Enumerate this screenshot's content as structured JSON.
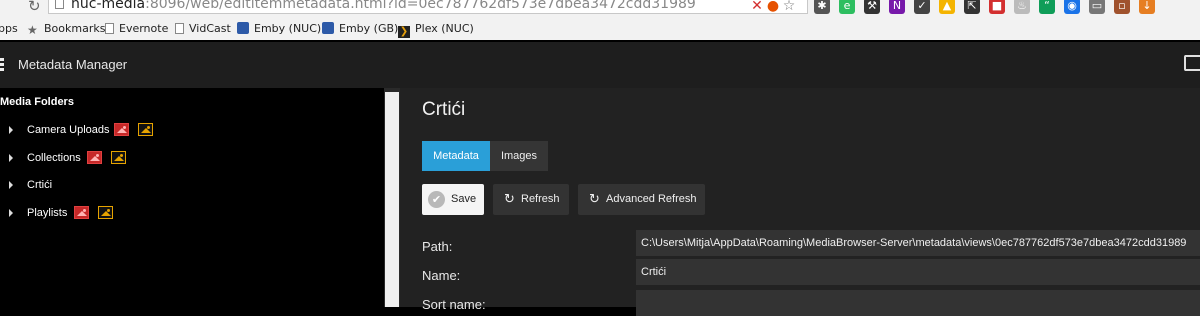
{
  "browser": {
    "url_host": "nuc-media",
    "url_rest": ":8096/web/edititemmetadata.html?id=0ec787762df573e7dbea3472cdd31989",
    "bookmarks": [
      {
        "label": "pps",
        "icon": "apps-icon"
      },
      {
        "label": "Bookmarks",
        "icon": "star-icon"
      },
      {
        "label": "Evernote",
        "icon": "page-icon"
      },
      {
        "label": "VidCast",
        "icon": "page-icon"
      },
      {
        "label": "Emby (NUC)",
        "icon": "emby-icon"
      },
      {
        "label": "Emby (GB)",
        "icon": "emby-icon"
      },
      {
        "label": "Plex (NUC)",
        "icon": "plex-icon"
      }
    ],
    "extensions": [
      {
        "icon": "puzzle-icon",
        "color": "#555555"
      },
      {
        "icon": "evernote-icon",
        "color": "#2dbe60"
      },
      {
        "icon": "tool-icon",
        "color": "#333333"
      },
      {
        "icon": "onenote-icon",
        "color": "#7719aa"
      },
      {
        "icon": "pocket-icon",
        "color": "#444444"
      },
      {
        "icon": "drive-icon",
        "color": "#f4b400"
      },
      {
        "icon": "pin-icon",
        "color": "#333333"
      },
      {
        "icon": "pdf-icon",
        "color": "#d32f2f"
      },
      {
        "icon": "bell-icon",
        "color": "#bbbbbb"
      },
      {
        "icon": "hangouts-icon",
        "color": "#0f9d58"
      },
      {
        "icon": "globe-icon",
        "color": "#1a73e8"
      },
      {
        "icon": "cast-icon",
        "color": "#777777"
      },
      {
        "icon": "briefcase-icon",
        "color": "#a0522d"
      },
      {
        "icon": "download-icon",
        "color": "#e67e22"
      }
    ]
  },
  "header": {
    "title": "Metadata Manager"
  },
  "sidebar": {
    "heading": "Media Folders",
    "items": [
      {
        "label": "Camera Uploads",
        "status_icons": [
          "red",
          "orange"
        ]
      },
      {
        "label": "Collections",
        "status_icons": [
          "red",
          "orange"
        ]
      },
      {
        "label": "Crtići",
        "status_icons": []
      },
      {
        "label": "Playlists",
        "status_icons": [
          "red",
          "orange"
        ]
      }
    ]
  },
  "main": {
    "title": "Crtići",
    "tabs": [
      {
        "label": "Metadata",
        "active": true
      },
      {
        "label": "Images",
        "active": false
      }
    ],
    "buttons": {
      "save": "Save",
      "refresh": "Refresh",
      "advanced_refresh": "Advanced Refresh"
    },
    "fields": [
      {
        "label": "Path:",
        "value": "C:\\Users\\Mitja\\AppData\\Roaming\\MediaBrowser-Server\\metadata\\views\\0ec787762df573e7dbea3472cdd31989"
      },
      {
        "label": "Name:",
        "value": "Crtići"
      },
      {
        "label": "Sort name:",
        "value": ""
      }
    ]
  },
  "colors": {
    "accent": "#2a9fd8",
    "missing_image": "#c62828",
    "missing_backdrop": "#e6a300"
  }
}
